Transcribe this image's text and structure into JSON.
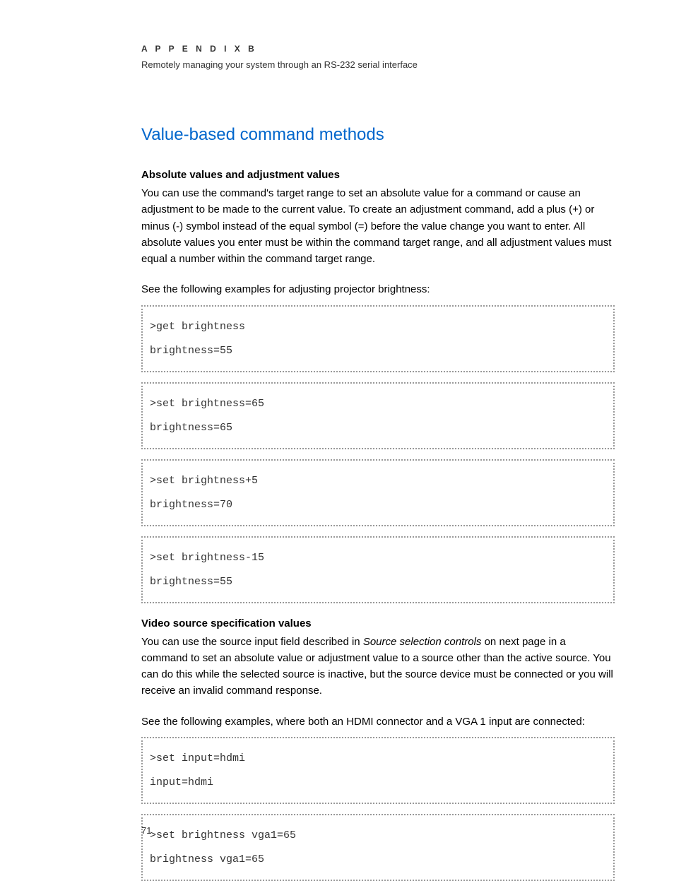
{
  "header": {
    "appendix": "A P P E N D I X   B",
    "subtitle": "Remotely managing your system through an RS-232 serial interface"
  },
  "section": {
    "title": "Value-based command methods"
  },
  "absolute": {
    "heading": "Absolute values and adjustment values",
    "p1": "You can use the command's target range to set an absolute value for a command or cause an adjustment to be made to the current value. To create an adjustment command, add a plus (+) or minus (-) symbol instead of the equal symbol (=) before the value change you want to enter. All absolute values you enter must be within the command target range, and all adjustment values must equal a number within the command target range.",
    "p2": "See the following examples for adjusting projector brightness:"
  },
  "code1": ">get brightness\nbrightness=55",
  "code2": ">set brightness=65\nbrightness=65",
  "code3": ">set brightness+5\nbrightness=70",
  "code4": ">set brightness-15\nbrightness=55",
  "video": {
    "heading": "Video source specification values",
    "p1a": "You can use the source input field described in ",
    "p1_italic": "Source selection controls",
    "p1b": " on next page in a command to set an absolute value or adjustment value to a source other than the active source. You can do this while the selected source is inactive, but the source device must be connected or you will receive an invalid command response.",
    "p2": "See the following examples, where both an HDMI connector and a VGA 1 input are connected:"
  },
  "code5": ">set input=hdmi\ninput=hdmi",
  "code6": ">set brightness vga1=65\nbrightness vga1=65",
  "pagenum": "71"
}
